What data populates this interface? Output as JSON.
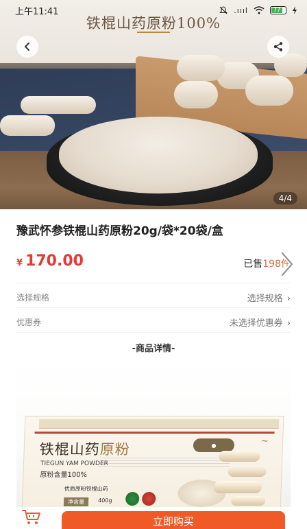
{
  "status_bar": {
    "time": "上午11:41",
    "signal": ".ıııl",
    "battery": "77"
  },
  "hero": {
    "overlay_title": "铁棍山药原粉100%",
    "page_indicator": "4/4",
    "back_icon": "‹",
    "share_icon": "share-icon"
  },
  "product": {
    "title": "豫武怀参铁棍山药原粉20g/袋*20袋/盒",
    "currency": "¥",
    "price": "170.00",
    "sold_label": "已售",
    "sold_count": "198",
    "sold_unit": "件"
  },
  "options": {
    "spec_label": "选择规格",
    "spec_value": "选择规格",
    "coupon_label": "优惠券",
    "coupon_value": "未选择优惠券"
  },
  "detail": {
    "section_title": "-商品详情-",
    "box_name": "铁棍山药",
    "box_name_accent": "原粉",
    "box_en": "TIEGUN YAM POWDER",
    "box_content": "原粉含量100%",
    "box_net_label": "净含量",
    "box_net_value": "400g",
    "box_maker": "优质原粉铁棍山药"
  },
  "actions": {
    "buy_label": "立即购买"
  },
  "colors": {
    "accent": "#f05a26",
    "price": "#e53935"
  }
}
